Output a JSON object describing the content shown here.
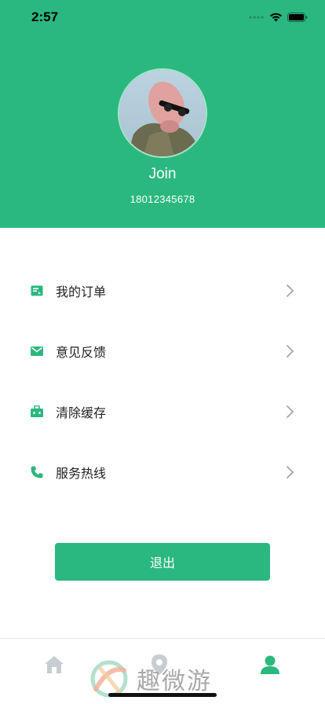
{
  "status_bar": {
    "time": "2:57"
  },
  "profile": {
    "name": "Join",
    "phone": "18012345678"
  },
  "menu": [
    {
      "label": "我的订单",
      "icon": "receipt-icon"
    },
    {
      "label": "意见反馈",
      "icon": "mail-icon"
    },
    {
      "label": "清除缓存",
      "icon": "briefcase-icon"
    },
    {
      "label": "服务热线",
      "icon": "phone-icon"
    }
  ],
  "logout_label": "退出",
  "tabbar": [
    {
      "icon": "home-icon",
      "active": false
    },
    {
      "icon": "map-pin-icon",
      "active": false
    },
    {
      "icon": "user-icon",
      "active": true
    }
  ],
  "watermark": {
    "text": "趣微游"
  },
  "colors": {
    "primary": "#2bb87f",
    "inactive": "#c9ccd3",
    "text": "#222222"
  }
}
